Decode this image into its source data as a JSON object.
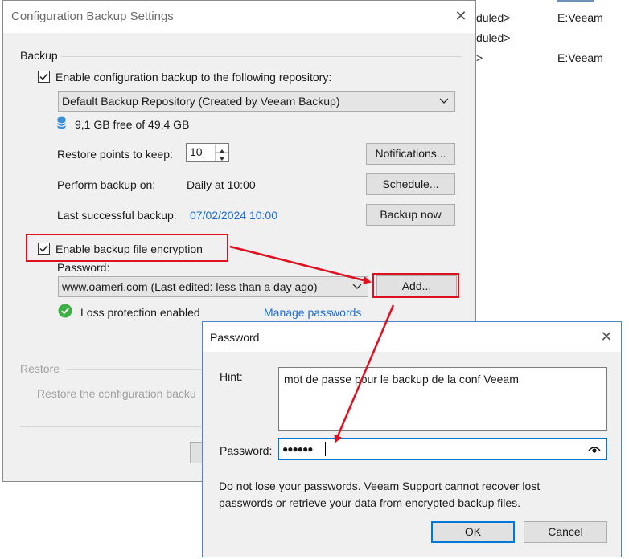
{
  "background_window": {
    "rows": [
      {
        "status": "duled>",
        "target": "E:Veeam"
      },
      {
        "status": "duled>",
        "target": ""
      },
      {
        "status": ">",
        "target": "E:Veeam"
      }
    ]
  },
  "main_dialog": {
    "title": "Configuration Backup Settings",
    "backup_group": {
      "label": "Backup",
      "enable_checkbox_label": "Enable configuration backup to the following repository:",
      "enable_checked": true,
      "repository_value": "Default Backup Repository (Created by Veeam Backup)",
      "free_space": "9,1 GB free of 49,4 GB",
      "restore_points_label": "Restore points to keep:",
      "restore_points_value": "10",
      "perform_backup_label": "Perform backup on:",
      "perform_backup_value": "Daily at 10:00",
      "last_backup_label": "Last successful backup:",
      "last_backup_value": "07/02/2024 10:00",
      "notifications_button": "Notifications...",
      "schedule_button": "Schedule...",
      "backup_now_button": "Backup now",
      "encryption_checkbox_label": "Enable backup file encryption",
      "encryption_checked": true,
      "password_label": "Password:",
      "password_value": "www.oameri.com (Last edited: less than a day ago)",
      "add_button": "Add...",
      "loss_protection_text": "Loss protection enabled",
      "manage_passwords_link": "Manage passwords"
    },
    "restore_group": {
      "label": "Restore",
      "description": "Restore the configuration backu"
    }
  },
  "password_dialog": {
    "title": "Password",
    "hint_label": "Hint:",
    "hint_value": "mot de passe pour le backup de la conf Veeam",
    "password_label": "Password:",
    "password_value": "●●●●●●",
    "warning_line1": "Do not lose your passwords. Veeam Support cannot recover lost",
    "warning_line2": "passwords or retrieve your data from encrypted backup files.",
    "ok_button": "OK",
    "cancel_button": "Cancel"
  },
  "colors": {
    "annotation_red": "#e01020",
    "link_blue": "#1a6fd6",
    "success_green": "#3cb043",
    "focus_blue": "#0078d7"
  }
}
